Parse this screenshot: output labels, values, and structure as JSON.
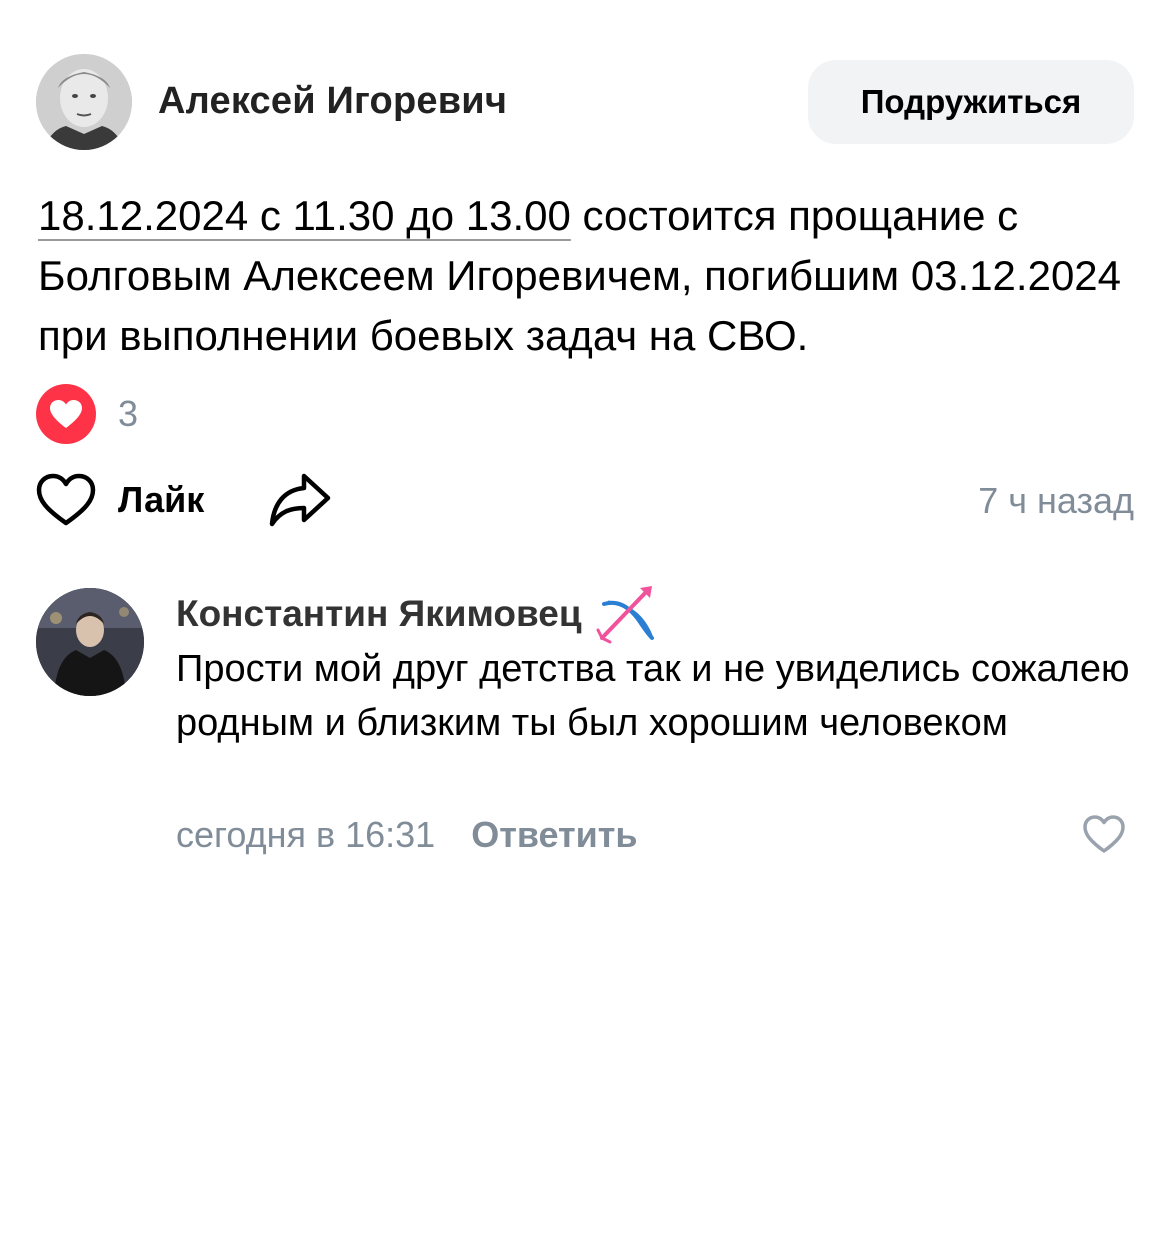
{
  "post": {
    "author": "Алексей Игоревич",
    "friend_button": "Подружиться",
    "text_date": "18.12.2024 с 11.30",
    "text_mid": " до",
    "text_time_end": " 13.00",
    "text_rest": " состоится прощание с Болговым Алексеем Игоревичем, погибшим 03.12.2024 при выполнении боевых задач на СВО.",
    "reaction_count": "3",
    "like_label": "Лайк",
    "time": "7 ч назад",
    "reaction_color": "#ff3347"
  },
  "comment": {
    "author": "Константин Якимовец",
    "status_emoji": "sagittarius-bow-icon",
    "text": "Прости мой друг детства так и не увиделись сожалею родным и близким ты был хорошим человеком",
    "time": "сегодня в 16:31",
    "reply_label": "Ответить"
  },
  "colors": {
    "secondary_text": "#818c99",
    "button_bg": "#f2f3f5"
  }
}
